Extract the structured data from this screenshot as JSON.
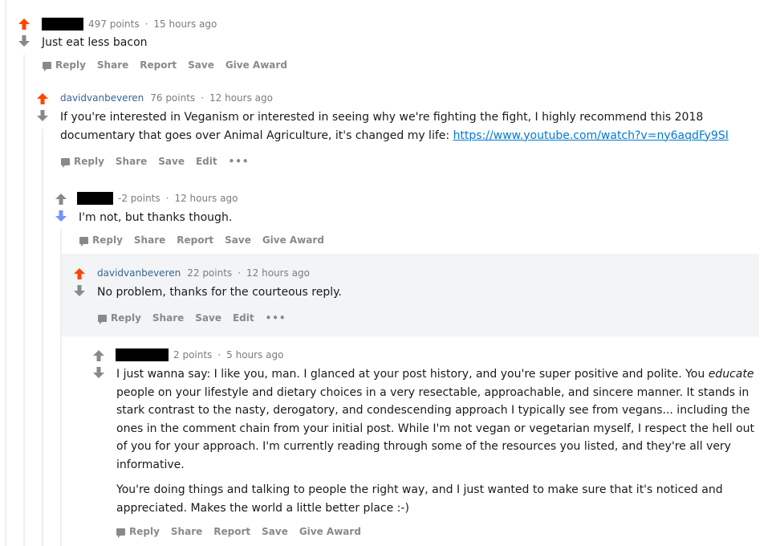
{
  "colors": {
    "upvoted": "#ff4500",
    "downvoted": "#7193ff",
    "neutral": "#878a8c",
    "username": "#336699",
    "link": "#0079d3",
    "highlight_bg": "#f2f4f6"
  },
  "comments": [
    {
      "author": "",
      "author_redacted": true,
      "points": "497 points",
      "time": "15 hours ago",
      "vote": "up",
      "body": [
        "Just eat less bacon"
      ],
      "actions": [
        "Reply",
        "Share",
        "Report",
        "Save",
        "Give Award"
      ]
    },
    {
      "author": "davidvanbeveren",
      "author_redacted": false,
      "points": "76 points",
      "time": "12 hours ago",
      "vote": "up",
      "body_pre": "If you're interested in Veganism or interested in seeing why we're fighting the fight, I highly recommend this 2018 documentary that goes over Animal Agriculture, it's changed my life: ",
      "link": "https://www.youtube.com/watch?v=ny6aqdFy9SI",
      "actions": [
        "Reply",
        "Share",
        "Save",
        "Edit",
        "•••"
      ]
    },
    {
      "author": "",
      "author_redacted": true,
      "points": "-2 points",
      "time": "12 hours ago",
      "vote": "down",
      "body": [
        "I'm not, but thanks though."
      ],
      "actions": [
        "Reply",
        "Share",
        "Report",
        "Save",
        "Give Award"
      ]
    },
    {
      "author": "davidvanbeveren",
      "author_redacted": false,
      "points": "22 points",
      "time": "12 hours ago",
      "vote": "up",
      "body": [
        "No problem, thanks for the courteous reply."
      ],
      "actions": [
        "Reply",
        "Share",
        "Save",
        "Edit",
        "•••"
      ],
      "highlighted": true
    },
    {
      "author": "",
      "author_redacted": true,
      "points": "2 points",
      "time": "5 hours ago",
      "vote": "none",
      "p1_a": "I just wanna say: I like you, man. I glanced at your post history, and you're super positive and polite. You ",
      "p1_em": "educate",
      "p1_b": " people on your lifestyle and dietary choices in a very resectable, approachable, and sincere manner. It stands in stark contrast to the nasty, derogatory, and condescending approach I typically see from vegans... including the ones in the comment chain from your initial post. While I'm not vegan or vegetarian myself, I respect the hell out of you for your approach. I'm currently reading through some of the resources you listed, and they're all very informative.",
      "p2": "You're doing things and talking to people the right way, and I just wanted to make sure that it's noticed and appreciated. Makes the world a little better place :-)",
      "actions": [
        "Reply",
        "Share",
        "Report",
        "Save",
        "Give Award"
      ]
    }
  ]
}
